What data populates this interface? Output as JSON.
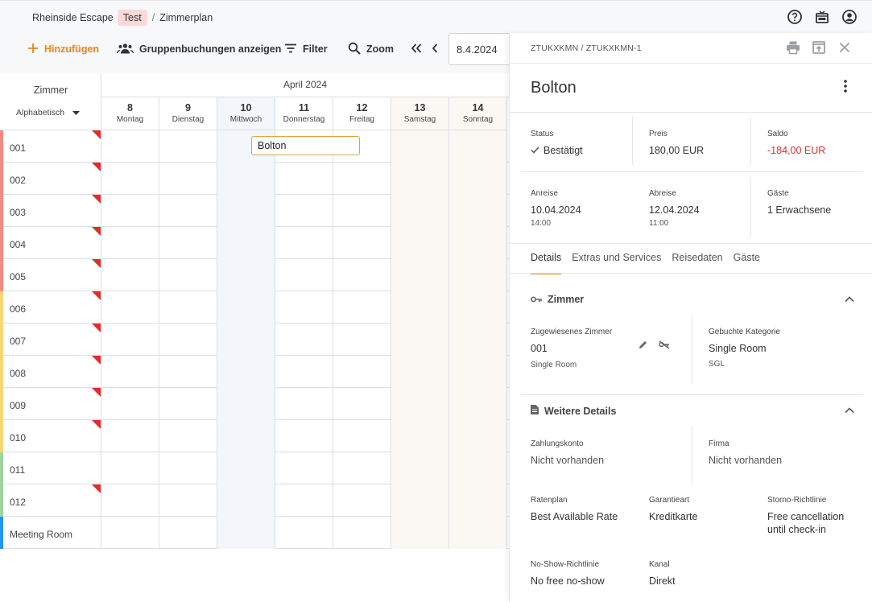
{
  "topbar": {
    "property": "Rheinside Escape",
    "env_tag": "Test",
    "separator": "/",
    "page": "Zimmerplan",
    "icons": [
      "help-icon",
      "ticket-icon",
      "account-icon"
    ]
  },
  "toolbar": {
    "add_label": "Hinzufügen",
    "groups_label": "Gruppenbuchungen anzeigen",
    "filter_label": "Filter",
    "zoom_label": "Zoom",
    "date_value": "8.4.2024"
  },
  "grid": {
    "room_header": "Zimmer",
    "sort_label": "Alphabetisch",
    "month": "April 2024",
    "days": [
      {
        "num": "8",
        "name": "Montag"
      },
      {
        "num": "9",
        "name": "Dienstag"
      },
      {
        "num": "10",
        "name": "Mittwoch"
      },
      {
        "num": "11",
        "name": "Donnerstag"
      },
      {
        "num": "12",
        "name": "Freitag"
      },
      {
        "num": "13",
        "name": "Samstag"
      },
      {
        "num": "14",
        "name": "Sonntag"
      }
    ],
    "rooms": [
      {
        "name": "001",
        "color": "#f28b82",
        "flag": true
      },
      {
        "name": "002",
        "color": "#f28b82",
        "flag": true
      },
      {
        "name": "003",
        "color": "#f28b82",
        "flag": true
      },
      {
        "name": "004",
        "color": "#f28b82",
        "flag": true
      },
      {
        "name": "005",
        "color": "#f28b82",
        "flag": true
      },
      {
        "name": "006",
        "color": "#f7d774",
        "flag": true
      },
      {
        "name": "007",
        "color": "#f7d774",
        "flag": true
      },
      {
        "name": "008",
        "color": "#f7d774",
        "flag": true
      },
      {
        "name": "009",
        "color": "#f7d774",
        "flag": true
      },
      {
        "name": "010",
        "color": "#f7d774",
        "flag": true
      },
      {
        "name": "011",
        "color": "#9fd49f",
        "flag": false
      },
      {
        "name": "012",
        "color": "#9fd49f",
        "flag": true
      },
      {
        "name": "Meeting Room",
        "color": "#2196f3",
        "flag": false
      }
    ],
    "booking": {
      "guest": "Bolton"
    }
  },
  "panel": {
    "code": "ZTUKXKMN / ZTUKXKMN-1",
    "title": "Bolton",
    "status_label": "Status",
    "status_value": "Bestätigt",
    "price_label": "Preis",
    "price_value": "180,00 EUR",
    "balance_label": "Saldo",
    "balance_value": "-184,00 EUR",
    "arrival_label": "Anreise",
    "arrival_date": "10.04.2024",
    "arrival_time": "14:00",
    "departure_label": "Abreise",
    "departure_date": "12.04.2024",
    "departure_time": "11:00",
    "guests_label": "Gäste",
    "guests_value": "1 Erwachsene",
    "tabs": [
      "Details",
      "Extras und Services",
      "Reisedaten",
      "Gäste"
    ],
    "room_section": "Zimmer",
    "assigned_room_label": "Zugewiesenes Zimmer",
    "assigned_room_value": "001",
    "assigned_room_sub": "Single Room",
    "booked_category_label": "Gebuchte Kategorie",
    "booked_category_value": "Single Room",
    "booked_category_sub": "SGL",
    "more_section": "Weitere Details",
    "payment_label": "Zahlungskonto",
    "payment_value": "Nicht vorhanden",
    "company_label": "Firma",
    "company_value": "Nicht vorhanden",
    "rateplan_label": "Ratenplan",
    "rateplan_value": "Best Available Rate",
    "guarantee_label": "Garantieart",
    "guarantee_value": "Kreditkarte",
    "cancel_label": "Storno-Richtlinie",
    "cancel_value": "Free cancellation until check-in",
    "noshow_label": "No-Show-Richtlinie",
    "noshow_value": "No free no-show",
    "channel_label": "Kanal",
    "channel_value": "Direkt"
  },
  "colors": {
    "accent": "#e8861a",
    "error": "#d32f2f",
    "booking_border": "#e0a339",
    "flag": "#e32b2b"
  }
}
